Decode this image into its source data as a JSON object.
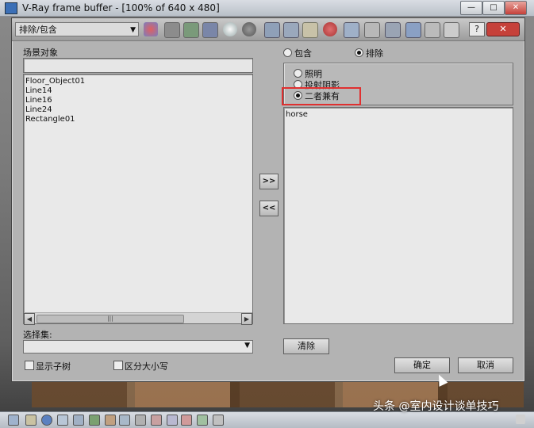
{
  "window": {
    "title": "V-Ray frame buffer - [100% of 640 x 480]",
    "min_btn": "—",
    "max_btn": "□",
    "close_btn": "✕"
  },
  "dialog": {
    "dropdown_title": "排除/包含",
    "help_btn": "?",
    "close_btn": "✕",
    "scene_objects": {
      "label": "场景对象",
      "filter_value": "",
      "items": [
        "Floor_Object01",
        "Line14",
        "Line16",
        "Line24",
        "Rectangle01"
      ]
    },
    "move_right_btn": ">>",
    "move_left_btn": "<<",
    "mode": {
      "include_label": "包含",
      "exclude_label": "排除",
      "selected": "exclude"
    },
    "type": {
      "illumination_label": "照明",
      "shadow_label": "投射阴影",
      "both_label": "二者兼有",
      "selected": "both"
    },
    "excluded_items": [
      "horse"
    ],
    "clear_btn": "清除",
    "selection_set": {
      "label": "选择集:",
      "value": ""
    },
    "show_subtree_label": "显示子树",
    "case_sensitive_label": "区分大小写",
    "ok_btn": "确定",
    "cancel_btn": "取消"
  },
  "watermark": "头条 @室内设计谈单技巧",
  "colors": {
    "highlight": "#e03030",
    "dialog_bg": "#b3b3b3"
  }
}
